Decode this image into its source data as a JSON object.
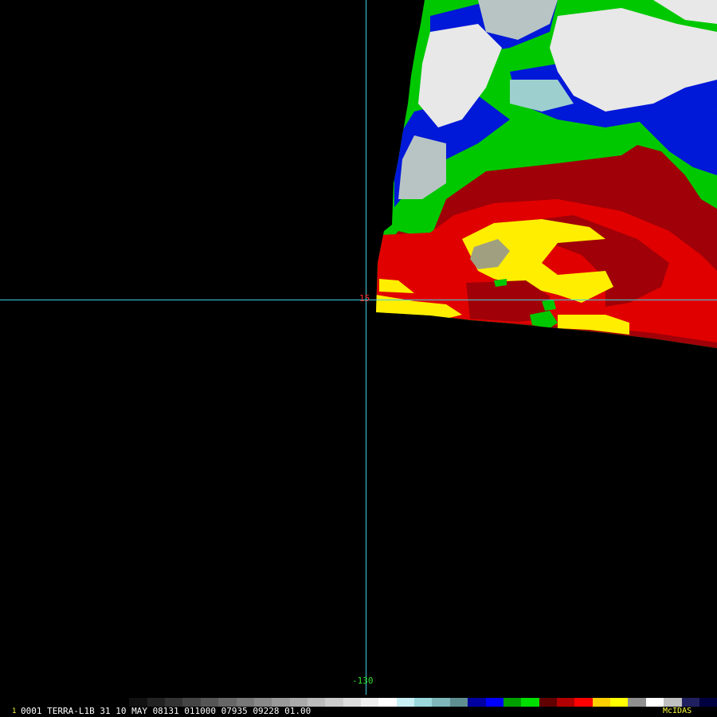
{
  "grid": {
    "latitude_label": "15",
    "longitude_label": "-130",
    "line_color": "#3fd0e0",
    "latitude_label_color": "#ff3030",
    "longitude_label_color": "#30e030"
  },
  "footer": {
    "frame_number": "1",
    "caption": "0001 TERRA-L1B 31 10 MAY 08131 011000 07935 09228 01.00",
    "brand": "McIDAS",
    "colorbar": [
      "#000000",
      "#111111",
      "#222222",
      "#333333",
      "#444444",
      "#555555",
      "#666666",
      "#777777",
      "#888888",
      "#999999",
      "#aaaaaa",
      "#bbbbbb",
      "#cccccc",
      "#dddddd",
      "#eeeeee",
      "#ffffff",
      "#c8f0f4",
      "#9ad8dc",
      "#7fb7ba",
      "#5f8f90",
      "#0000a0",
      "#0000ff",
      "#00a000",
      "#00e000",
      "#600000",
      "#b00000",
      "#ff0000",
      "#ffd000",
      "#ffff00",
      "#909090",
      "#ffffff",
      "#c0c0c0",
      "#202060",
      "#000040"
    ]
  },
  "imagery": {
    "colors": {
      "white_cloud": "#e8e8e8",
      "light_gray": "#b8c4c4",
      "cyan_gray": "#9ecfcf",
      "blue": "#0018d8",
      "green": "#00c800",
      "dark_red": "#a00008",
      "red": "#e00000",
      "yellow": "#ffee00",
      "gray_core": "#a0a080"
    }
  }
}
